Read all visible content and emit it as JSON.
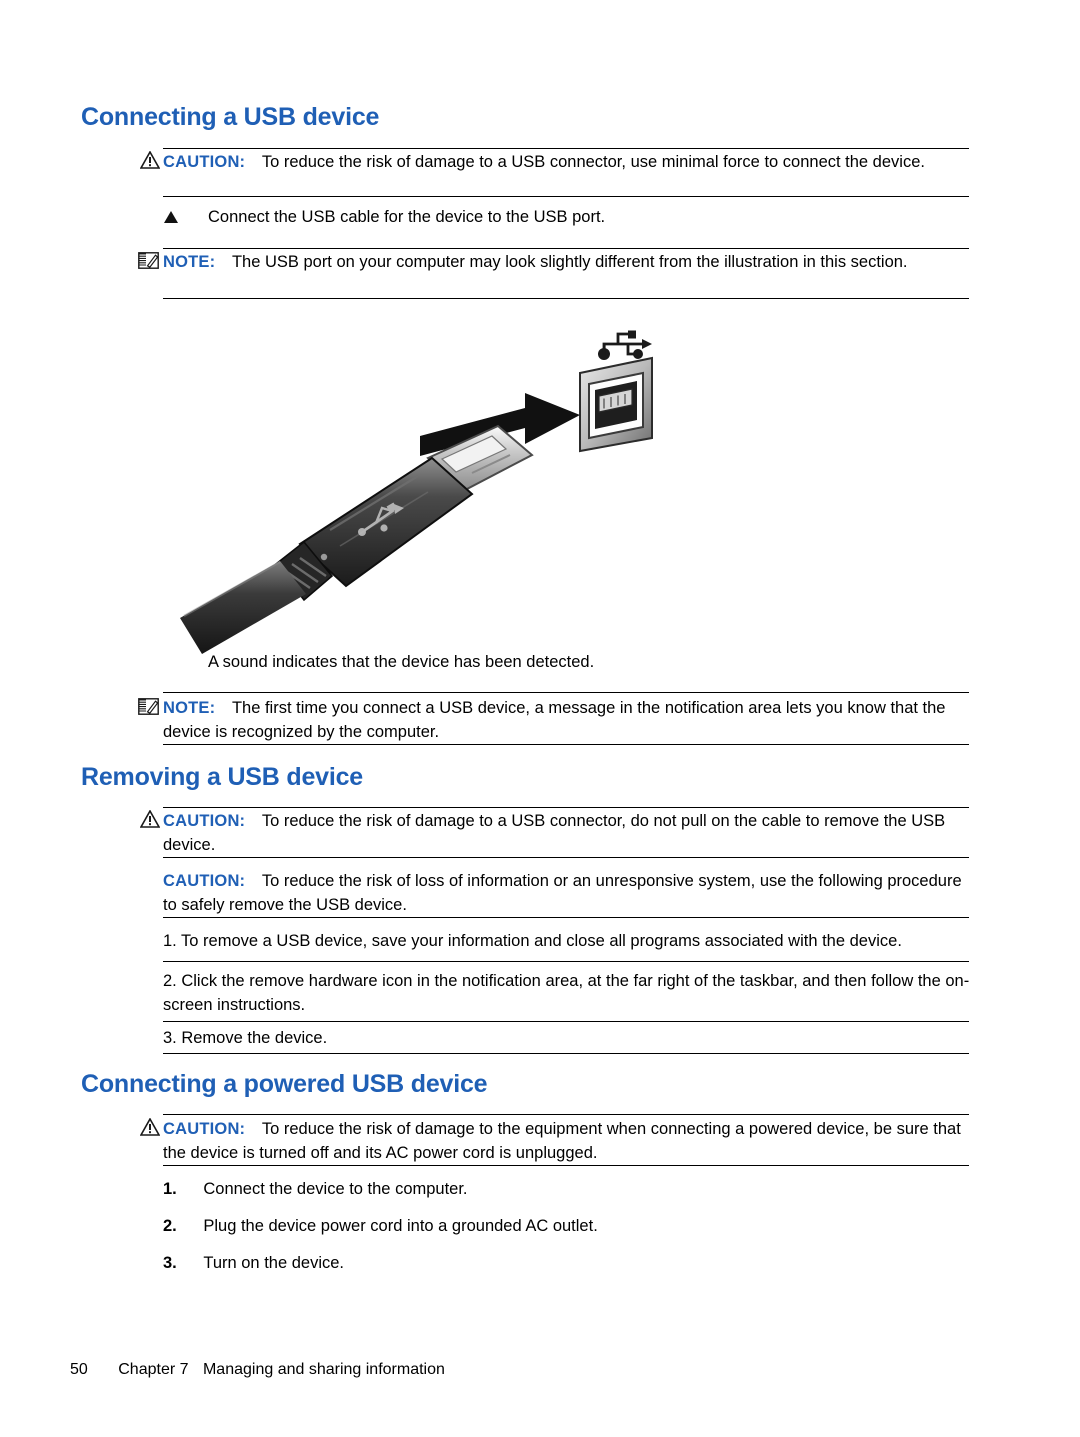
{
  "page": {
    "number": "50",
    "chapter": "Chapter 7",
    "chapter_title": "Managing and sharing information"
  },
  "sections": [
    {
      "heading": "Connecting a USB device",
      "caution_label": "CAUTION:",
      "caution_text": "To reduce the risk of damage to a USB connector, use minimal force to connect the device.",
      "step_text": "Connect the USB cable for the device to the USB port.",
      "note_label": "NOTE:",
      "note_text": "The USB port on your computer may look slightly different from the illustration in this section.",
      "caption": "A sound indicates that the device has been detected.",
      "note2_label": "NOTE:",
      "note2_text": "The first time you connect a USB device, a message in the notification area lets you know that the device is recognized by the computer."
    },
    {
      "heading": "Removing a USB device",
      "caution1_label": "CAUTION:",
      "caution1_text": "To reduce the risk of damage to a USB connector, do not pull on the cable to remove the USB device.",
      "caution2_label": "CAUTION:",
      "caution2_text": "To reduce the risk of loss of information or an unresponsive system, use the following procedure to safely remove the USB device.",
      "steps": [
        "1. To remove a USB device, save your information and close all programs associated with the device.",
        "2. Click the remove hardware icon in the notification area, at the far right of the taskbar, and then follow the on-screen instructions.",
        "3. Remove the device."
      ]
    },
    {
      "heading": "Connecting a powered USB device",
      "caution_label": "CAUTION:",
      "caution_text": "To reduce the risk of damage to the equipment when connecting a powered device, be sure that the device is turned off and its AC power cord is unplugged.",
      "steps": [
        {
          "num": "1.",
          "text": "Connect the device to the computer."
        },
        {
          "num": "2.",
          "text": "Plug the device power cord into a grounded AC outlet."
        },
        {
          "num": "3.",
          "text": "Turn on the device."
        }
      ]
    }
  ],
  "illustration": {
    "alt": "USB cable connector being inserted into a USB port",
    "usb_symbol": "usb-trident"
  },
  "colors": {
    "heading_blue": "#1f5fb5",
    "admonition_blue": "#1f5fb5",
    "rule": "#000000",
    "text": "#000000"
  }
}
